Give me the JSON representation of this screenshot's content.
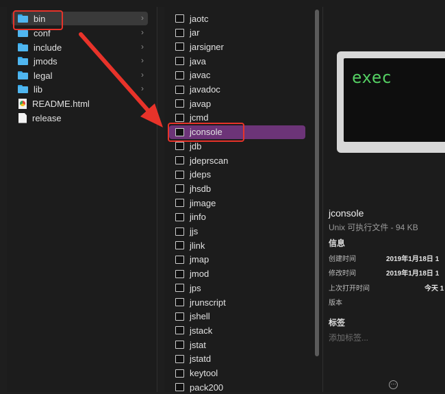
{
  "sidebar": {
    "items": [
      {
        "label": "bin",
        "icon": "folder-icon",
        "chevron": "›"
      },
      {
        "label": "conf",
        "icon": "folder-icon",
        "chevron": "›"
      },
      {
        "label": "include",
        "icon": "folder-icon",
        "chevron": "›"
      },
      {
        "label": "jmods",
        "icon": "folder-icon",
        "chevron": "›"
      },
      {
        "label": "legal",
        "icon": "folder-icon",
        "chevron": "›"
      },
      {
        "label": "lib",
        "icon": "folder-icon",
        "chevron": "›"
      },
      {
        "label": "README.html",
        "icon": "html-file-icon"
      },
      {
        "label": "release",
        "icon": "document-icon"
      }
    ]
  },
  "files": {
    "items": [
      "jaotc",
      "jar",
      "jarsigner",
      "java",
      "javac",
      "javadoc",
      "javap",
      "jcmd",
      "jconsole",
      "jdb",
      "jdeprscan",
      "jdeps",
      "jhsdb",
      "jimage",
      "jinfo",
      "jjs",
      "jlink",
      "jmap",
      "jmod",
      "jps",
      "jrunscript",
      "jshell",
      "jstack",
      "jstat",
      "jstatd",
      "keytool",
      "pack200"
    ],
    "selected": "jconsole"
  },
  "preview": {
    "thumb_text": "exec",
    "name": "jconsole",
    "kind_size": "Unix 可执行文件 - 94 KB",
    "info_header": "信息",
    "meta": [
      {
        "key": "创建时间",
        "value": "2019年1月18日 1"
      },
      {
        "key": "修改时间",
        "value": "2019年1月18日 1"
      },
      {
        "key": "上次打开时间",
        "value": "今天 1"
      },
      {
        "key": "版本",
        "value": ""
      }
    ],
    "tags_header": "标签",
    "tags_placeholder": "添加标签...",
    "more_glyph": "⋯"
  },
  "colors": {
    "selection": "#6c3478",
    "annotation": "#e8332a",
    "terminal_text": "#54d063"
  }
}
